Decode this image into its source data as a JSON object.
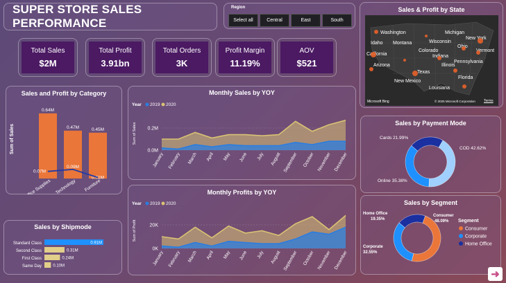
{
  "title": "SUPER STORE SALES PERFORMANCE",
  "region": {
    "label": "Region",
    "options": [
      "Select all",
      "Central",
      "East",
      "South"
    ]
  },
  "kpis": [
    {
      "label": "Total Sales",
      "value": "$2M"
    },
    {
      "label": "Total Profit",
      "value": "3.91bn"
    },
    {
      "label": "Total Orders",
      "value": "3K"
    },
    {
      "label": "Profit Margin",
      "value": "11.19%"
    },
    {
      "label": "AOV",
      "value": "$521"
    }
  ],
  "map": {
    "title": "Sales & Profit by State",
    "states": [
      "Washington",
      "Montana",
      "Idaho",
      "California",
      "Colorado",
      "Arizona",
      "New Mexico",
      "Texas",
      "Michigan",
      "Wisconsin",
      "Indiana",
      "Illinois",
      "New York",
      "Ohio",
      "Vermont",
      "Pennsylvania",
      "Florida",
      "Louisiana"
    ],
    "credit_left": "Microsoft Bing",
    "credit_right": "© 2025 Microsoft Corporation",
    "credit_terms": "Terms"
  },
  "colors": {
    "orange": "#ea7639",
    "blue2019": "#2a7de1",
    "tan2020": "#d9c274",
    "navy": "#1f3aa6",
    "shipbar": "#1e90ff",
    "shiptan": "#e2cf8a",
    "kpi_bg": "#4b1a63"
  },
  "chart_data": [
    {
      "id": "category",
      "type": "bar",
      "title": "Sales and Profit by Category",
      "ylabel": "Sum of Sales",
      "categories": [
        "Office Supplies",
        "Technology",
        "Furniture"
      ],
      "series": [
        {
          "name": "Sales",
          "values": [
            0.64,
            0.47,
            0.45
          ],
          "labels": [
            "0.64M",
            "0.47M",
            "0.45M"
          ]
        },
        {
          "name": "Profit",
          "values": [
            0.07,
            0.09,
            0.01
          ],
          "labels": [
            "0.07M",
            "0.09M",
            "0.01M"
          ]
        }
      ],
      "ylim": [
        0,
        0.7
      ]
    },
    {
      "id": "shipmode",
      "type": "bar",
      "title": "Sales by Shipmode",
      "categories": [
        "Standard Class",
        "Second Class",
        "First Class",
        "Same Day"
      ],
      "values": [
        0.91,
        0.31,
        0.24,
        0.1
      ],
      "labels": [
        "0.91M",
        "0.31M",
        "0.24M",
        "0.10M"
      ],
      "xlim": [
        0,
        0.91
      ]
    },
    {
      "id": "monthly_sales",
      "type": "area",
      "title": "Monthly Sales by YOY",
      "legend_title": "Year",
      "ylabel": "Sum of Sales",
      "ticks": [
        "0.0M",
        "0.2M"
      ],
      "ylim": [
        0,
        0.3
      ],
      "x": [
        "January",
        "February",
        "March",
        "April",
        "May",
        "June",
        "July",
        "August",
        "September",
        "October",
        "November",
        "December"
      ],
      "series": [
        {
          "name": "2019",
          "values": [
            0.02,
            0.01,
            0.05,
            0.03,
            0.05,
            0.04,
            0.04,
            0.04,
            0.07,
            0.05,
            0.08,
            0.08
          ]
        },
        {
          "name": "2020",
          "values": [
            0.1,
            0.1,
            0.16,
            0.11,
            0.14,
            0.14,
            0.13,
            0.14,
            0.26,
            0.17,
            0.23,
            0.27
          ]
        }
      ]
    },
    {
      "id": "monthly_profit",
      "type": "area",
      "title": "Monthly Profits by YOY",
      "legend_title": "Year",
      "ylabel": "Sum of Profit",
      "ticks": [
        "0K",
        "20K"
      ],
      "ylim": [
        0,
        30
      ],
      "x": [
        "January",
        "February",
        "March",
        "April",
        "May",
        "June",
        "July",
        "August",
        "September",
        "October",
        "November",
        "December"
      ],
      "series": [
        {
          "name": "2019",
          "values": [
            2,
            1,
            5,
            2,
            6,
            5,
            4,
            4,
            8,
            14,
            12,
            18
          ]
        },
        {
          "name": "2020",
          "values": [
            10,
            8,
            18,
            9,
            19,
            13,
            15,
            11,
            21,
            27,
            16,
            28
          ]
        }
      ]
    },
    {
      "id": "payment",
      "type": "pie",
      "title": "Sales by Payment Mode",
      "slices": [
        {
          "name": "COD",
          "value": 42.62,
          "label": "COD 42.62%"
        },
        {
          "name": "Online",
          "value": 35.38,
          "label": "Online 35.38%"
        },
        {
          "name": "Cards",
          "value": 21.99,
          "label": "Cards 21.99%"
        }
      ]
    },
    {
      "id": "segment",
      "type": "pie",
      "title": "Sales by Segment",
      "legend_title": "Segment",
      "slices": [
        {
          "name": "Consumer",
          "value": 48.09,
          "label_name": "Consumer",
          "label_pct": "48.09%"
        },
        {
          "name": "Corporate",
          "value": 32.55,
          "label_name": "Corporate",
          "label_pct": "32.55%"
        },
        {
          "name": "Home Office",
          "value": 19.35,
          "label_name": "Home Office",
          "label_pct": "19.35%"
        }
      ]
    }
  ]
}
